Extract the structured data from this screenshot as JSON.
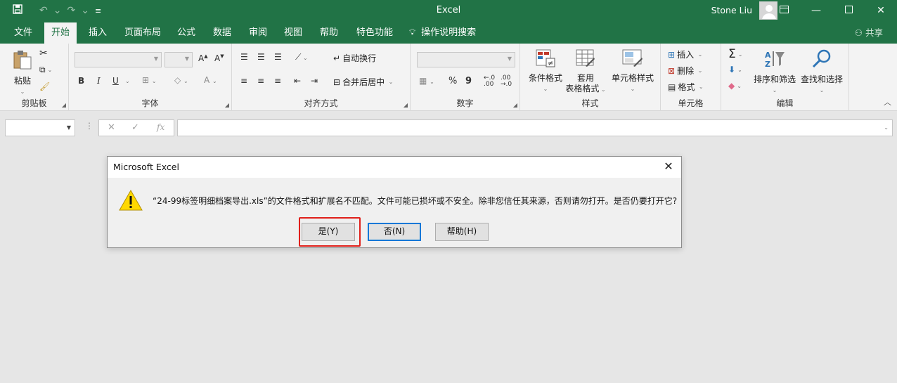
{
  "colors": {
    "accent": "#217346",
    "highlight": "#e0201b",
    "warning": "#ffd800",
    "focus": "#0078d7"
  },
  "titlebar": {
    "app_title": "Excel",
    "user": "Stone Liu",
    "icons": [
      "save-icon",
      "undo-icon",
      "redo-icon",
      "customize-qat-icon",
      "ribbon-display-icon",
      "minimize-icon",
      "maximize-icon",
      "close-icon"
    ]
  },
  "tabs": [
    {
      "label": "文件"
    },
    {
      "label": "开始",
      "active": true
    },
    {
      "label": "插入"
    },
    {
      "label": "页面布局"
    },
    {
      "label": "公式"
    },
    {
      "label": "数据"
    },
    {
      "label": "审阅"
    },
    {
      "label": "视图"
    },
    {
      "label": "帮助"
    },
    {
      "label": "特色功能"
    }
  ],
  "tell_me": "操作说明搜索",
  "share": "共享",
  "ribbon": {
    "clipboard": {
      "label": "剪贴板",
      "paste": "粘贴"
    },
    "font": {
      "label": "字体",
      "bold": "B",
      "italic": "I",
      "underline": "U"
    },
    "alignment": {
      "label": "对齐方式",
      "wrap": "自动换行",
      "merge": "合并后居中"
    },
    "number": {
      "label": "数字",
      "percent": "%",
      "comma": "9"
    },
    "styles": {
      "label": "样式",
      "conditional": "条件格式",
      "table_line1": "套用",
      "table_line2": "表格格式",
      "cell_styles": "单元格样式"
    },
    "cells": {
      "label": "单元格",
      "insert": "插入",
      "delete": "删除",
      "format": "格式"
    },
    "editing": {
      "label": "编辑",
      "sort": "排序和筛选",
      "find": "查找和选择"
    }
  },
  "formula_bar": {
    "fx": "fx",
    "cancel": "✕",
    "enter": "✓"
  },
  "dialog": {
    "title": "Microsoft Excel",
    "message": "“24-99标签明细档案导出.xls”的文件格式和扩展名不匹配。文件可能已损坏或不安全。除非您信任其来源，否则请勿打开。是否仍要打开它?",
    "yes": "是(Y)",
    "no": "否(N)",
    "help": "帮助(H)"
  }
}
